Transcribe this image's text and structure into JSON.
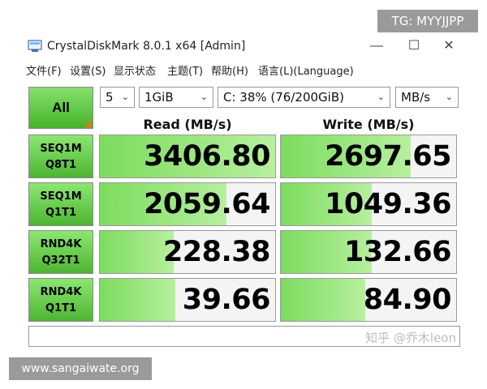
{
  "window": {
    "title": "CrystalDiskMark 8.0.1 x64 [Admin]"
  },
  "controls": {
    "minimize": "—",
    "maximize": "☐",
    "close": "✕"
  },
  "menu": [
    "文件(F)",
    "设置(S)",
    "显示状态",
    "主题(T)",
    "帮助(H)",
    "语言(L)(Language)"
  ],
  "toolbar": {
    "all_label": "All",
    "count": "5",
    "size": "1GiB",
    "drive": "C: 38% (76/200GiB)",
    "unit": "MB/s"
  },
  "headers": {
    "read": "Read (MB/s)",
    "write": "Write (MB/s)"
  },
  "tests": [
    {
      "line1": "SEQ1M",
      "line2": "Q8T1",
      "read": "3406.80",
      "write": "2697.65",
      "read_fill": 1.0,
      "write_fill": 0.74
    },
    {
      "line1": "SEQ1M",
      "line2": "Q1T1",
      "read": "2059.64",
      "write": "1049.36",
      "read_fill": 0.72,
      "write_fill": 0.52
    },
    {
      "line1": "RND4K",
      "line2": "Q32T1",
      "read": "228.38",
      "write": "132.66",
      "read_fill": 0.42,
      "write_fill": 0.52
    },
    {
      "line1": "RND4K",
      "line2": "Q1T1",
      "read": "39.66",
      "write": "84.90",
      "read_fill": 0.43,
      "write_fill": 0.48
    }
  ],
  "comment": "",
  "watermarks": {
    "zhihu": "知乎 @乔木leon",
    "tg": "TG: MYYJJPP",
    "site": "www.sangaiwate.org"
  },
  "colors": {
    "accent_green": "#4db532",
    "bar_green": "#7cdc5e",
    "corner_orange": "#e07a1c"
  }
}
